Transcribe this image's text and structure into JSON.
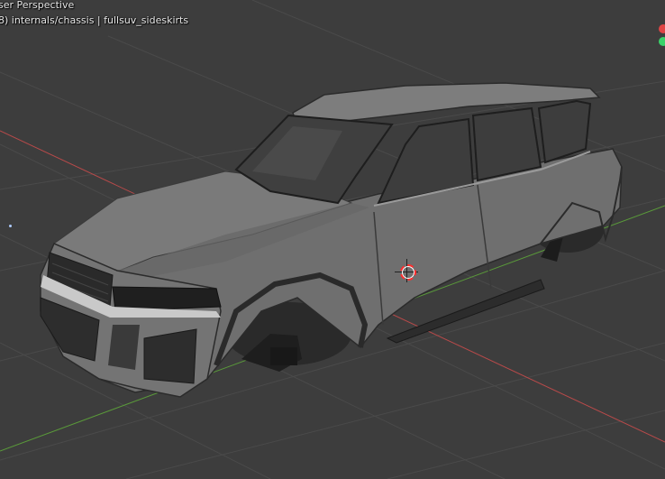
{
  "viewport": {
    "view_title": "ser Perspective",
    "object_info": "8) internals/chassis | fullsuv_sideskirts"
  },
  "colors": {
    "background": "#3d3d3d",
    "grid_line": "#4a4a4a",
    "axis_x": "#b84a4a",
    "axis_y": "#5a9a3a",
    "gizmo_x": "#e04545",
    "gizmo_y": "#3ad36a",
    "car_body": "#6f6f6f",
    "glass": "#3f3f3f"
  }
}
